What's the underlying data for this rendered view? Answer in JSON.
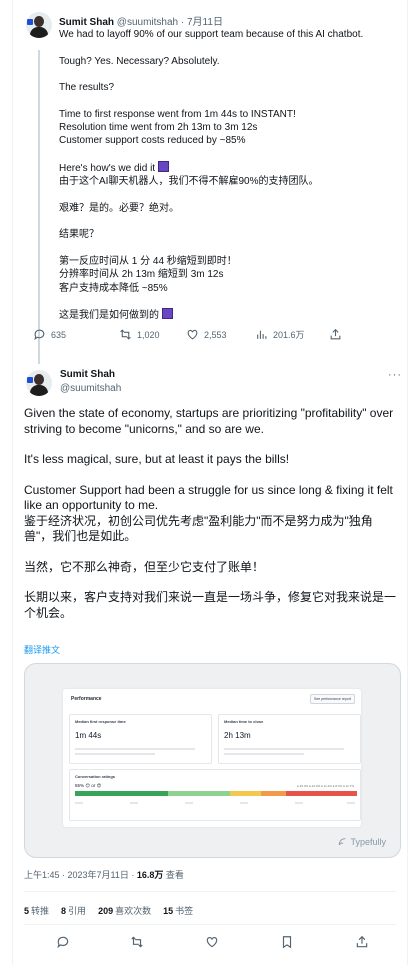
{
  "parent_tweet": {
    "name": "Sumit Shah",
    "handle": "@suumitshah",
    "dot": "·",
    "date": "7月11日",
    "lines": [
      "We had to layoff 90% of our support team because of this AI chatbot.",
      "",
      "Tough? Yes. Necessary? Absolutely.",
      "",
      "The results?",
      "",
      "Time to first response went from 1m 44s to INSTANT!",
      "Resolution time went from 2h 13m to 3m 12s",
      "Customer support costs reduced by ~85%",
      "",
      "Here's how's we did it",
      "由于这个AI聊天机器人，我们不得不解雇90%的支持团队。",
      "",
      "艰难？是的。必要？绝对。",
      "",
      "结果呢？",
      "",
      "第一反应时间从 1 分 44 秒缩短到即时！",
      "分辨率时间从 2h 13m 缩短到 3m 12s",
      "客户支持成本降低 ~85%",
      "",
      "这是我们是如何做到的"
    ],
    "actions": {
      "reply_count": "635",
      "retweet_count": "1,020",
      "like_count": "2,553",
      "view_count": "201.6万"
    }
  },
  "main_tweet": {
    "name": "Sumit Shah",
    "handle": "@suumitshah",
    "more_label": "···",
    "paragraphs": [
      "Given the state of economy, startups are prioritizing \"profitability\" over striving to become \"unicorns,\" and so are we.",
      "It's less magical, sure, but at least it pays the bills!",
      "Customer Support had been a struggle for us since long & fixing it felt like an opportunity to me.",
      "鉴于经济状况，初创公司优先考虑\"盈利能力\"而不是努力成为\"独角兽\"，我们也是如此。",
      "当然，它不那么神奇，但至少它支付了账单！",
      "长期以来，客户支持对我们来说一直是一场斗争，修复它对我来说是一个机会。"
    ],
    "translate_label": "翻译推文",
    "media": {
      "dashboard_title": "Performance",
      "dashboard_button": "See performance report",
      "metric1_label": "Median first response time",
      "metric1_value": "1m 44s",
      "metric2_label": "Median time to close",
      "metric2_value": "2h 13m",
      "ratings_label": "Conversation ratings",
      "ratings_pct": "55% 😊 or 😍",
      "ratings_legend": "● 46.3%  ● 22.2%  ● 11.4%  ● 8.4%  ● 11.7%",
      "watermark": "Typefully"
    },
    "timestamp": "上午1:45 · 2023年7月11日 · ",
    "views_number": "16.8万",
    "views_label": " 查看",
    "stats": [
      {
        "count": "5",
        "label": "转推"
      },
      {
        "count": "8",
        "label": "引用"
      },
      {
        "count": "209",
        "label": "喜欢次数"
      },
      {
        "count": "15",
        "label": "书签"
      }
    ]
  },
  "colors": {
    "text": "#0f1419",
    "muted": "#536471",
    "link": "#1d9bf0",
    "border": "#cfd9de",
    "rating_green_dark": "#3aa35a",
    "rating_green_light": "#8fd18f",
    "rating_yellow": "#f2c94c",
    "rating_orange": "#f2994a",
    "rating_red": "#e5534b"
  }
}
